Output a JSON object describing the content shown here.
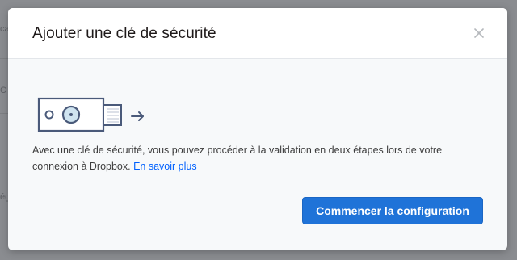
{
  "background": {
    "fragments": [
      "ca",
      "C",
      "ég"
    ]
  },
  "dialog": {
    "title": "Ajouter une clé de sécurité",
    "close_icon": "close-icon",
    "description": "Avec une clé de sécurité, vous pouvez procéder à la validation en deux étapes lors de votre connexion à Dropbox.",
    "learn_more": "En savoir plus",
    "primary_button": "Commencer la configuration"
  },
  "illustration": {
    "key_icon": "security-key-icon",
    "arrow_icon": "arrow-right-icon"
  },
  "colors": {
    "accent": "#1f73d8",
    "link": "#0061fe",
    "illustration_stroke": "#4a5a7a"
  }
}
